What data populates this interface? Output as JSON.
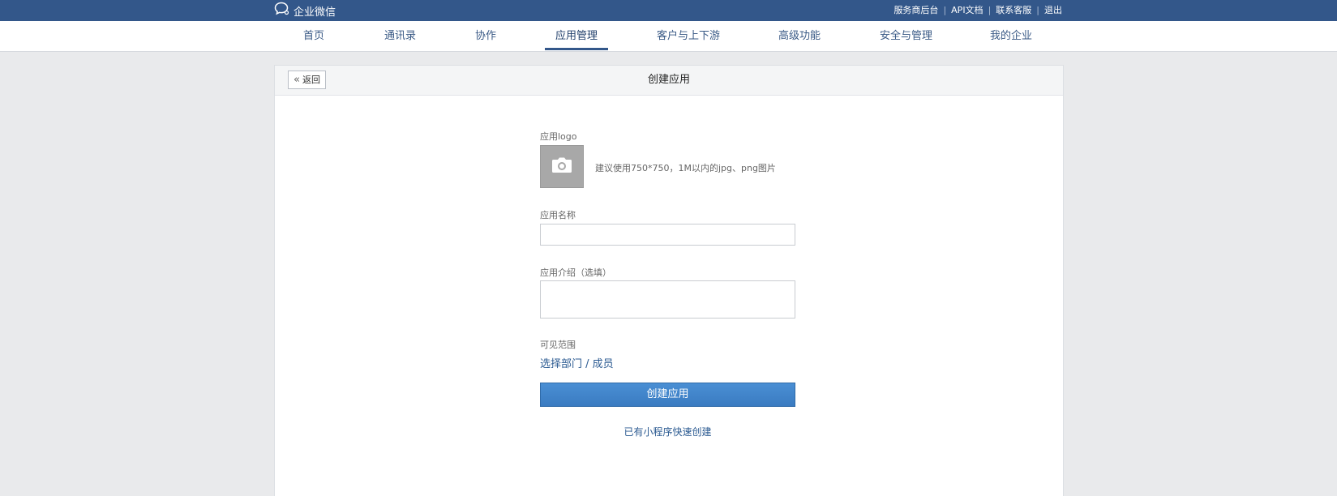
{
  "brand": {
    "name": "企业微信",
    "icon": "chat-bubble-icon"
  },
  "top_links": [
    "服务商后台",
    "API文档",
    "联系客服",
    "退出"
  ],
  "nav": {
    "items": [
      "首页",
      "通讯录",
      "协作",
      "应用管理",
      "客户与上下游",
      "高级功能",
      "安全与管理",
      "我的企业"
    ],
    "active": "应用管理"
  },
  "page": {
    "back_label": "返回",
    "title": "创建应用"
  },
  "form": {
    "logo_label": "应用logo",
    "logo_hint": "建议使用750*750，1M以内的jpg、png图片",
    "name_label": "应用名称",
    "name_value": "",
    "intro_label": "应用介绍（选填）",
    "intro_value": "",
    "scope_label": "可见范围",
    "scope_link": "选择部门 / 成员",
    "submit_label": "创建应用",
    "mini_program_link": "已有小程序快速创建"
  },
  "colors": {
    "topbar": "#33578a",
    "primary": "#3a7bc1",
    "link": "#2b5a91",
    "background": "#e9eaec"
  }
}
